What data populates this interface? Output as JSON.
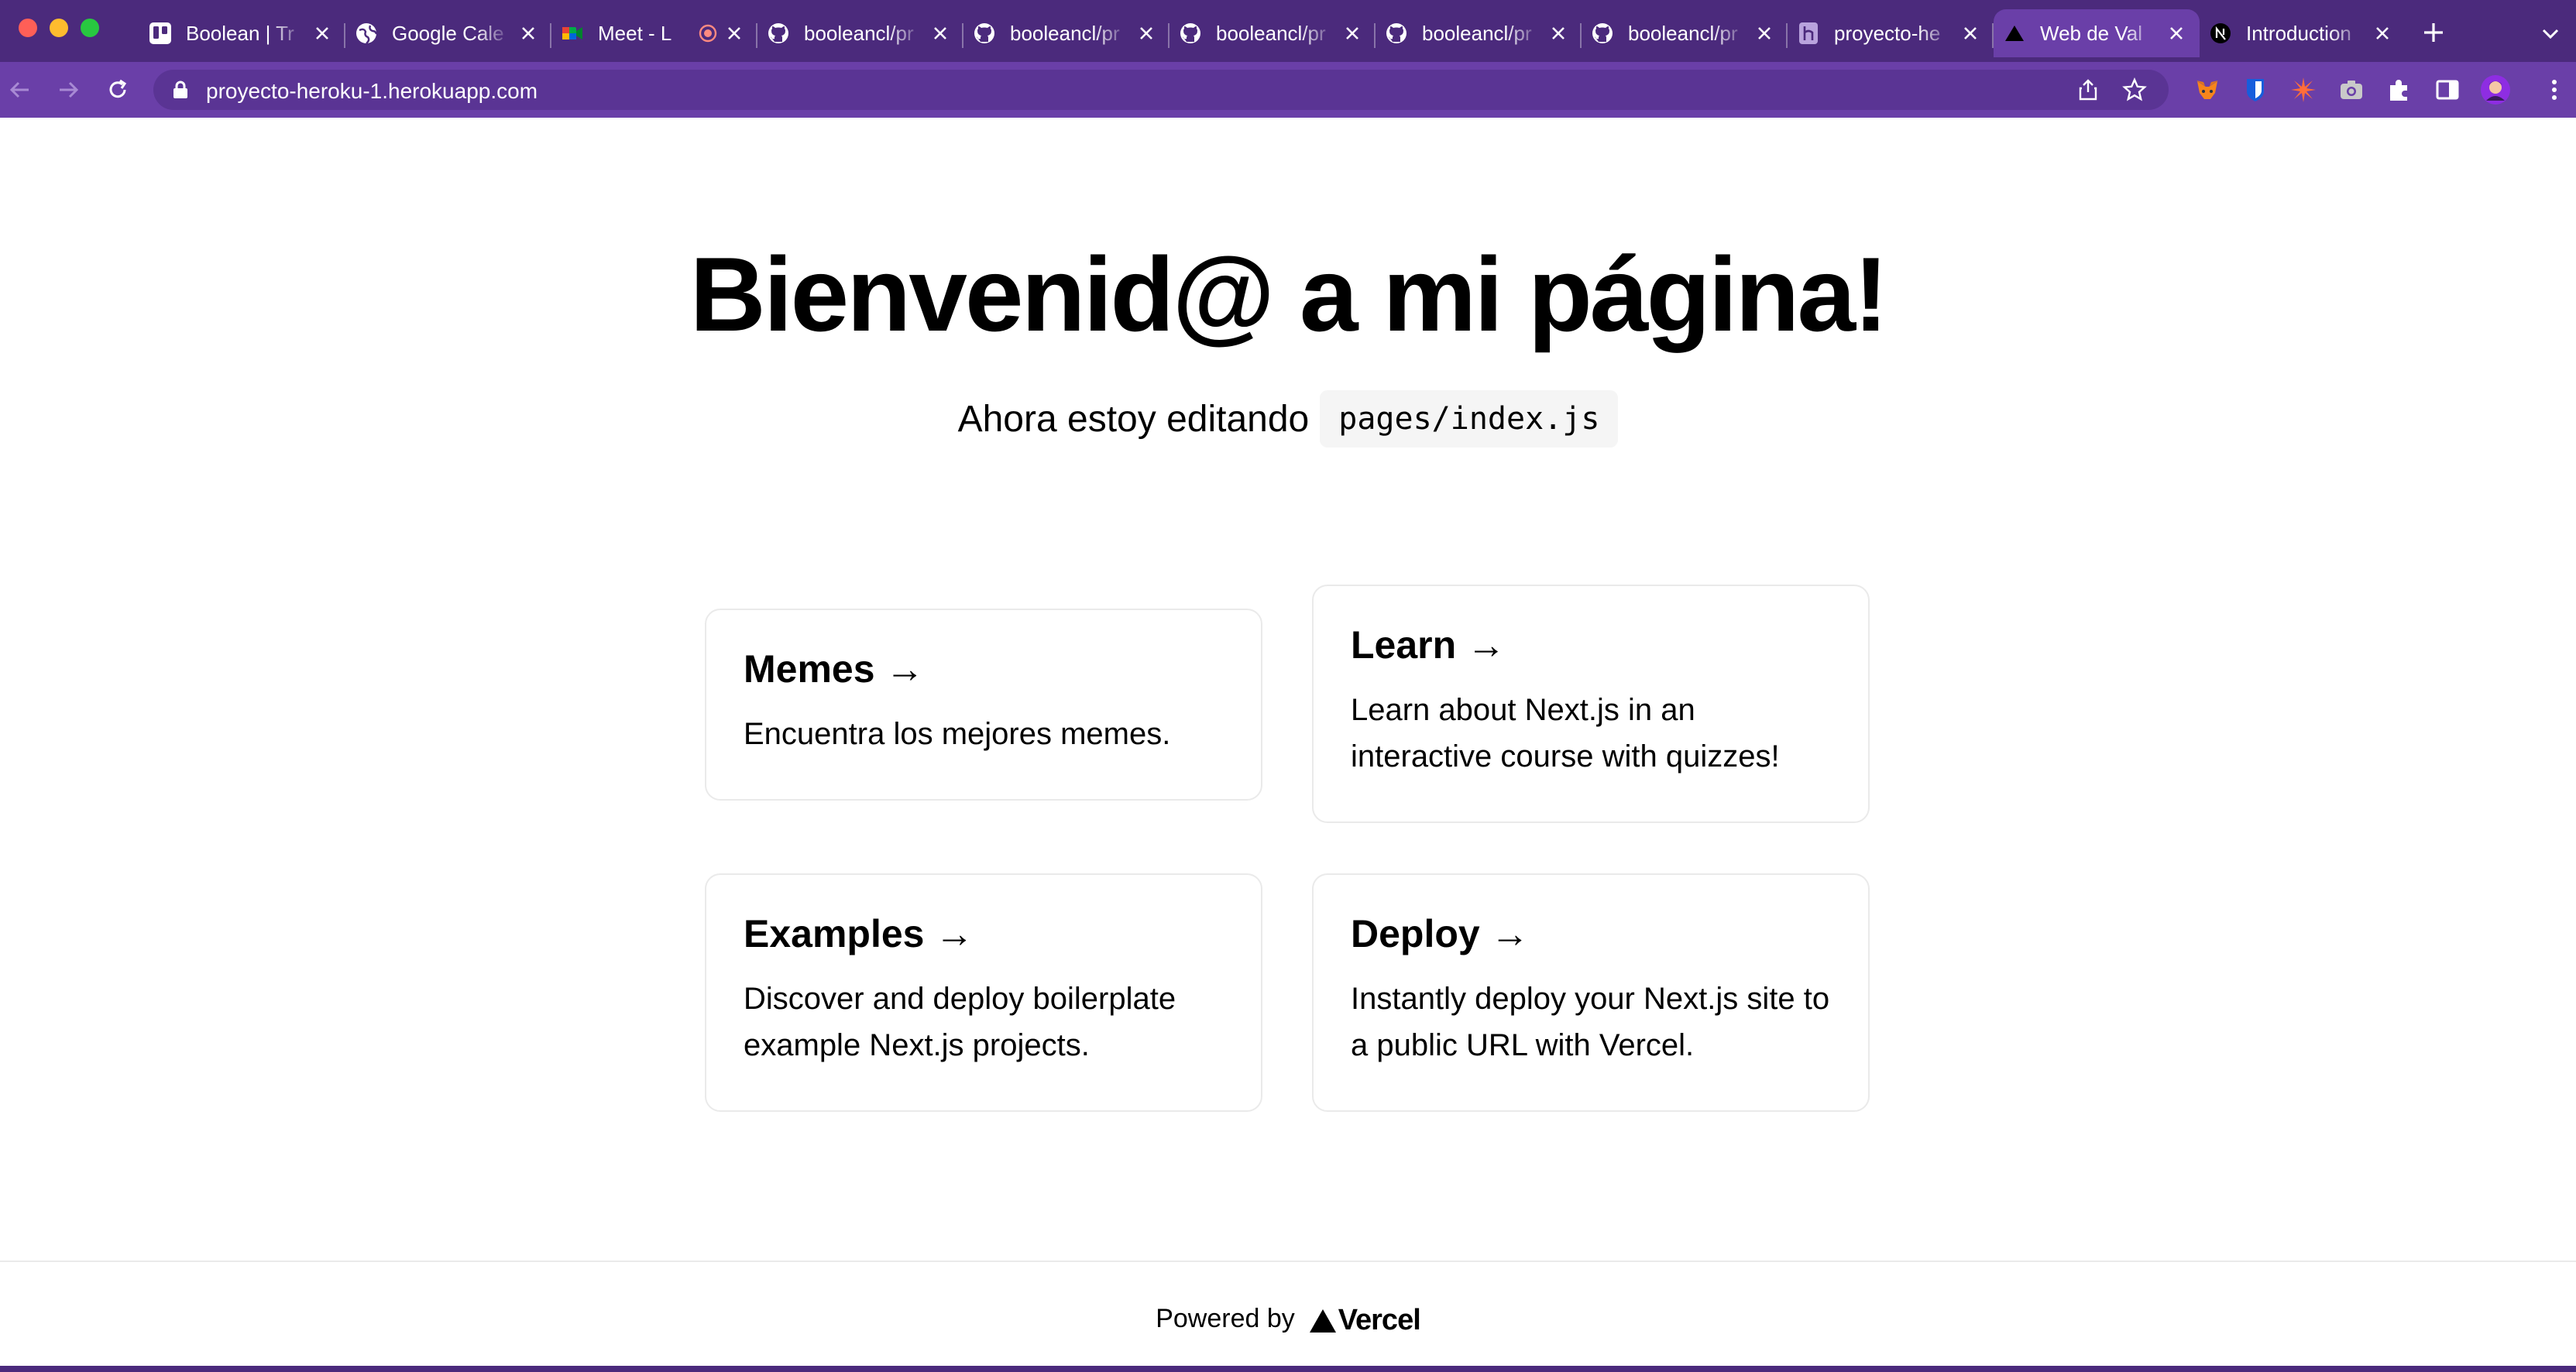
{
  "browser": {
    "tabs": [
      {
        "title": "Boolean | Tr",
        "favicon": "trello-icon"
      },
      {
        "title": "Google Cale",
        "favicon": "globe-icon"
      },
      {
        "title": "Meet - L",
        "favicon": "meet-icon"
      },
      {
        "title": "booleancl/pr",
        "favicon": "github-icon"
      },
      {
        "title": "booleancl/pr",
        "favicon": "github-icon"
      },
      {
        "title": "booleancl/pr",
        "favicon": "github-icon"
      },
      {
        "title": "booleancl/pr",
        "favicon": "github-icon"
      },
      {
        "title": "booleancl/pr",
        "favicon": "github-icon"
      },
      {
        "title": "proyecto-he",
        "favicon": "heroku-icon"
      },
      {
        "title": "Web de Val",
        "favicon": "vercel-triangle-icon",
        "active": true
      },
      {
        "title": "Introduction",
        "favicon": "nextjs-icon"
      }
    ],
    "url": "proyecto-heroku-1.herokuapp.com",
    "theme": {
      "tabbar": "#4b2a7c",
      "toolbar": "#6a3fa8"
    }
  },
  "page": {
    "heading": "Bienvenid@ a mi página!",
    "subtitle_text": "Ahora estoy editando",
    "subtitle_code": "pages/index.js",
    "cards": [
      {
        "title": "Memes →",
        "description": "Encuentra los mejores memes."
      },
      {
        "title": "Learn →",
        "description": "Learn about Next.js in an interactive course with quizzes!"
      },
      {
        "title": "Examples →",
        "description": "Discover and deploy boilerplate example Next.js projects."
      },
      {
        "title": "Deploy →",
        "description": "Instantly deploy your Next.js site to a public URL with Vercel."
      }
    ],
    "footer": {
      "powered_by": "Powered by",
      "brand": "Vercel"
    }
  }
}
